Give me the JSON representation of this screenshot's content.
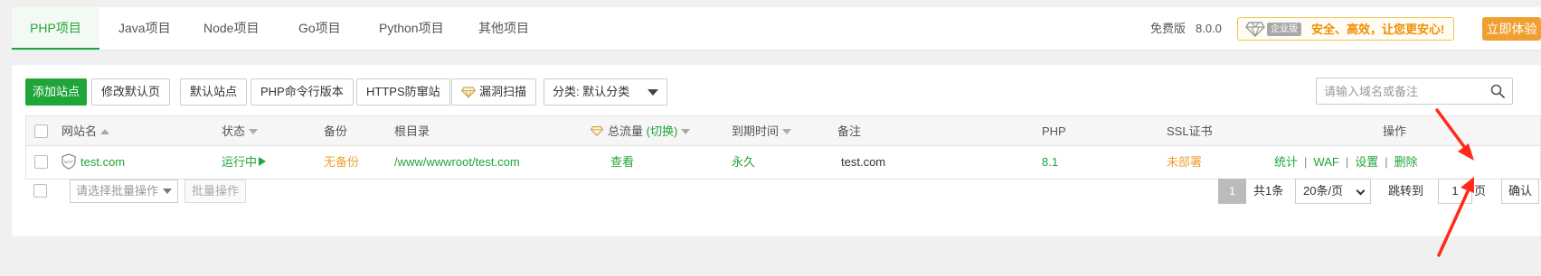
{
  "tabs": [
    {
      "label": "PHP项目",
      "active": true
    },
    {
      "label": "Java项目",
      "active": false
    },
    {
      "label": "Node项目",
      "active": false
    },
    {
      "label": "Go项目",
      "active": false
    },
    {
      "label": "Python项目",
      "active": false
    },
    {
      "label": "其他项目",
      "active": false
    }
  ],
  "version": {
    "edition": "免费版",
    "number": "8.0.0"
  },
  "enterprise": {
    "label": "企业版",
    "slogan": "安全、高效，让您更安心!",
    "try_label": "立即体验"
  },
  "toolbar": {
    "add_site": "添加站点",
    "edit_default_page": "修改默认页",
    "default_site": "默认站点",
    "php_cli_version": "PHP命令行版本",
    "https_firewall": "HTTPS防窜站",
    "vuln_scan": "漏洞扫描",
    "category": "分类: 默认分类",
    "search_placeholder": "请输入域名或备注"
  },
  "table": {
    "headers": {
      "site_name": "网站名",
      "status": "状态",
      "backup": "备份",
      "root": "根目录",
      "traffic": "总流量",
      "traffic_switch": "(切换)",
      "expiry": "到期时间",
      "remark": "备注",
      "php": "PHP",
      "ssl": "SSL证书",
      "actions": "操作"
    },
    "rows": [
      {
        "site_name": "test.com",
        "waf_badge": "WAF",
        "status": "运行中",
        "backup": "无备份",
        "root": "/www/wwwroot/test.com",
        "traffic": "查看",
        "expiry": "永久",
        "remark": "test.com",
        "php": "8.1",
        "ssl": "未部署",
        "actions": [
          "统计",
          "WAF",
          "设置",
          "删除"
        ]
      }
    ]
  },
  "footer": {
    "batch_placeholder": "请选择批量操作",
    "batch_button": "批量操作",
    "current_page": "1",
    "total": "共1条",
    "page_size": "20条/页",
    "jump_label": "跳转到",
    "jump_value": "1",
    "page_unit": "页",
    "confirm": "确认"
  },
  "colors": {
    "accent": "#20a53a",
    "warning": "#f0a030",
    "annotation_arrow": "#ff2a1a"
  }
}
